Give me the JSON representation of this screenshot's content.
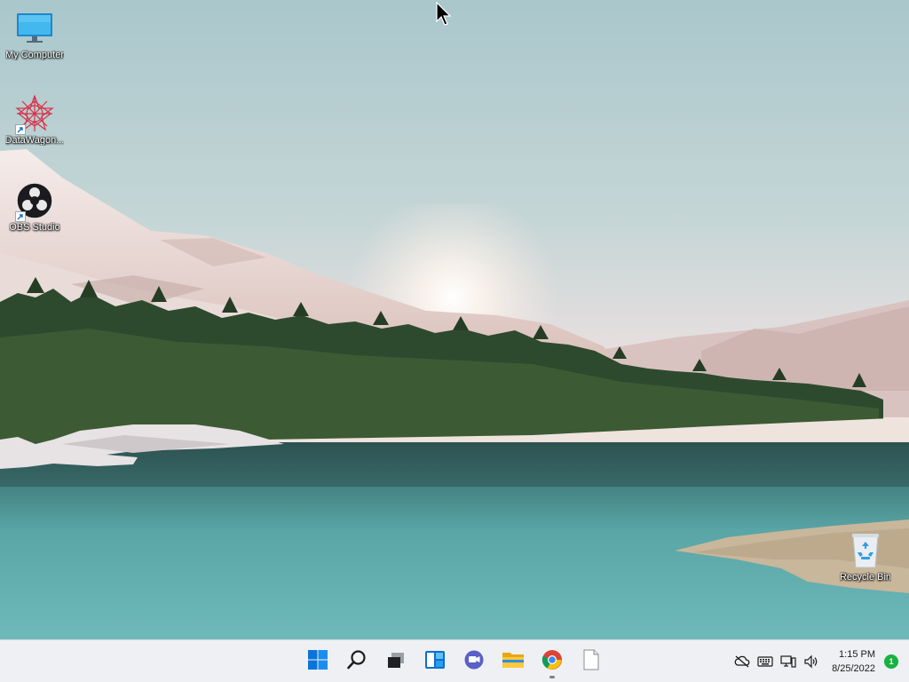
{
  "desktop": {
    "icons": [
      {
        "label": "My Computer",
        "icon": "monitor-icon"
      },
      {
        "label": "DataWagon...",
        "icon": "datawagon-icon"
      },
      {
        "label": "OBS Studio",
        "icon": "obs-icon"
      },
      {
        "label": "Recycle Bin",
        "icon": "recycle-bin-icon"
      }
    ]
  },
  "taskbar": {
    "apps": [
      {
        "name": "Start",
        "icon": "windows-start-icon"
      },
      {
        "name": "Search",
        "icon": "search-icon"
      },
      {
        "name": "Task View",
        "icon": "task-view-icon"
      },
      {
        "name": "Widgets",
        "icon": "widgets-icon"
      },
      {
        "name": "Chat",
        "icon": "chat-icon"
      },
      {
        "name": "File Explorer",
        "icon": "folder-icon"
      },
      {
        "name": "Google Chrome",
        "icon": "chrome-icon",
        "running": true
      },
      {
        "name": "Notepad",
        "icon": "blank-document-icon"
      }
    ],
    "tray": {
      "icons": [
        "cloud-offline-icon",
        "keyboard-icon",
        "network-icon",
        "volume-icon"
      ],
      "time": "1:15 PM",
      "date": "8/25/2022",
      "notification_count": "1"
    },
    "colors": {
      "accent": "#0078d4",
      "badge": "#17b23f"
    }
  }
}
